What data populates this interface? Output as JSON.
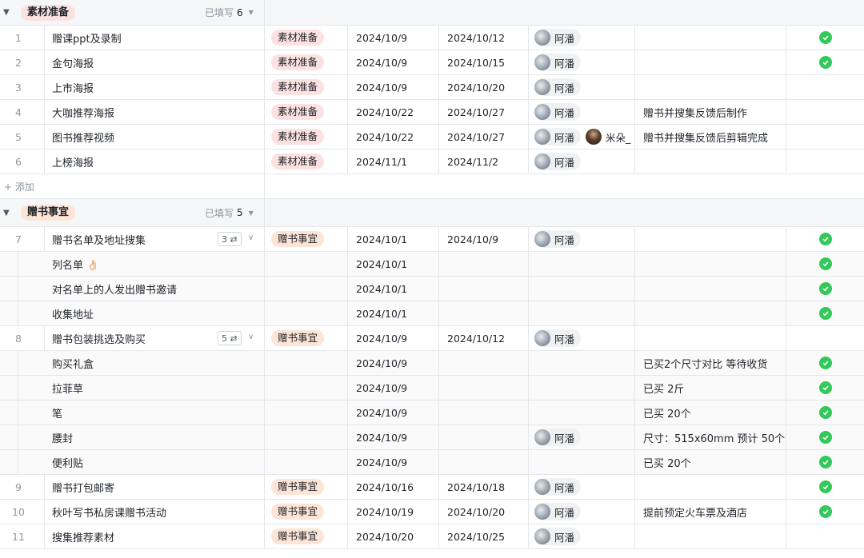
{
  "groups": [
    {
      "label": "素材准备",
      "filled_label": "已填写",
      "filled_count": "6",
      "color": "#fbe2e1"
    },
    {
      "label": "赠书事宜",
      "filled_label": "已填写",
      "filled_count": "5",
      "color": "#fce4d6"
    }
  ],
  "add_label": "+ 添加",
  "rows": [
    {
      "num": "1",
      "name": "赠课ppt及录制",
      "tag": "素材准备",
      "d1": "2024/10/9",
      "d2": "2024/10/12",
      "owners": [
        "阿潘"
      ],
      "note": "",
      "done": true
    },
    {
      "num": "2",
      "name": "金句海报",
      "tag": "素材准备",
      "d1": "2024/10/9",
      "d2": "2024/10/15",
      "owners": [
        "阿潘"
      ],
      "note": "",
      "done": true
    },
    {
      "num": "3",
      "name": "上市海报",
      "tag": "素材准备",
      "d1": "2024/10/9",
      "d2": "2024/10/20",
      "owners": [
        "阿潘"
      ],
      "note": "",
      "done": false
    },
    {
      "num": "4",
      "name": "大咖推荐海报",
      "tag": "素材准备",
      "d1": "2024/10/22",
      "d2": "2024/10/27",
      "owners": [
        "阿潘"
      ],
      "note": "赠书并搜集反馈后制作",
      "done": false
    },
    {
      "num": "5",
      "name": "图书推荐视频",
      "tag": "素材准备",
      "d1": "2024/10/22",
      "d2": "2024/10/27",
      "owners": [
        "阿潘",
        "米朵_"
      ],
      "note": "赠书并搜集反馈后剪辑完成",
      "done": false
    },
    {
      "num": "6",
      "name": "上榜海报",
      "tag": "素材准备",
      "d1": "2024/11/1",
      "d2": "2024/11/2",
      "owners": [
        "阿潘"
      ],
      "note": "",
      "done": false
    },
    {
      "num": "7",
      "name": "赠书名单及地址搜集",
      "sub_count": "3",
      "tag": "赠书事宜",
      "d1": "2024/10/1",
      "d2": "2024/10/9",
      "owners": [
        "阿潘"
      ],
      "note": "",
      "done": true
    },
    {
      "name": "列名单 👌🏻",
      "d1": "2024/10/1",
      "note": "",
      "done": true
    },
    {
      "name": "对名单上的人发出赠书邀请",
      "d1": "2024/10/1",
      "note": "",
      "done": true
    },
    {
      "name": "收集地址",
      "d1": "2024/10/1",
      "note": "",
      "done": true
    },
    {
      "num": "8",
      "name": "赠书包装挑选及购买",
      "sub_count": "5",
      "tag": "赠书事宜",
      "d1": "2024/10/9",
      "d2": "2024/10/12",
      "owners": [
        "阿潘"
      ],
      "note": "",
      "done": false
    },
    {
      "name": "购买礼盒",
      "d1": "2024/10/9",
      "note": "已买2个尺寸对比 等待收货",
      "done": true
    },
    {
      "name": "拉菲草",
      "d1": "2024/10/9",
      "note": "已买 2斤",
      "done": true
    },
    {
      "name": "笔",
      "d1": "2024/10/9",
      "note": "已买 20个",
      "done": true
    },
    {
      "name": "腰封",
      "d1": "2024/10/9",
      "owner": "阿潘",
      "note": "尺寸：515x60mm 预计 50个",
      "done": true
    },
    {
      "name": "便利贴",
      "d1": "2024/10/9",
      "note": "已买 20个",
      "done": true
    },
    {
      "num": "9",
      "name": "赠书打包邮寄",
      "tag": "赠书事宜",
      "d1": "2024/10/16",
      "d2": "2024/10/18",
      "owners": [
        "阿潘"
      ],
      "note": "",
      "done": true
    },
    {
      "num": "10",
      "name": "秋叶写书私房课赠书活动",
      "tag": "赠书事宜",
      "d1": "2024/10/19",
      "d2": "2024/10/20",
      "owners": [
        "阿潘"
      ],
      "note": "提前预定火车票及酒店",
      "done": true
    },
    {
      "num": "11",
      "name": "搜集推荐素材",
      "tag": "赠书事宜",
      "d1": "2024/10/20",
      "d2": "2024/10/25",
      "owners": [
        "阿潘"
      ],
      "note": "",
      "done": false
    }
  ]
}
